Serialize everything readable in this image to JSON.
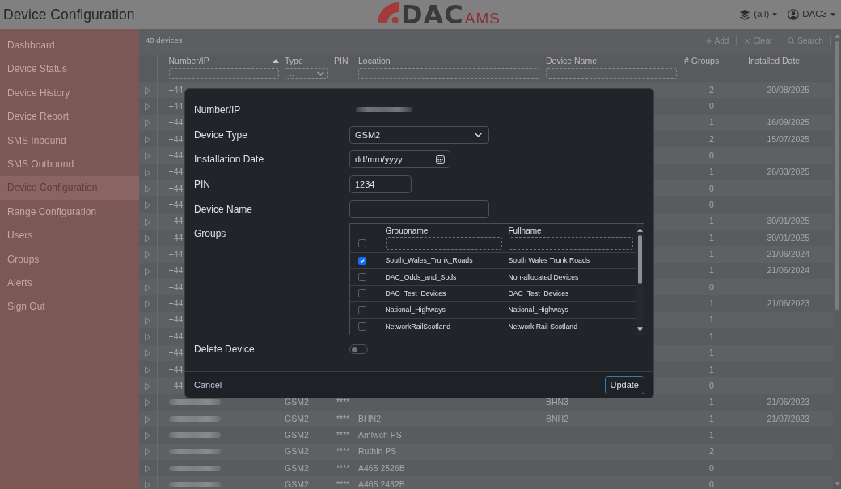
{
  "header": {
    "title": "Device Configuration",
    "logo": {
      "main": "DAC",
      "sub": "AMS"
    },
    "group_filter": "(all)",
    "user": "DAC3"
  },
  "sidebar": {
    "items": [
      {
        "label": "Dashboard",
        "selected": false
      },
      {
        "label": "Device Status",
        "selected": false
      },
      {
        "label": "Device History",
        "selected": false
      },
      {
        "label": "Device Report",
        "selected": false
      },
      {
        "label": "SMS Inbound",
        "selected": false
      },
      {
        "label": "SMS Outbound",
        "selected": false
      },
      {
        "label": "Device Configuration",
        "selected": true
      },
      {
        "label": "Range Configuration",
        "selected": false
      },
      {
        "label": "Users",
        "selected": false
      },
      {
        "label": "Groups",
        "selected": false
      },
      {
        "label": "Alerts",
        "selected": false
      },
      {
        "label": "Sign Out",
        "selected": false
      }
    ]
  },
  "toolbar": {
    "count": "40 devices",
    "actions": [
      {
        "kind": "add",
        "label": "Add"
      },
      {
        "kind": "clear",
        "label": "Clear"
      },
      {
        "kind": "search",
        "label": "Search"
      }
    ]
  },
  "table": {
    "columns": [
      {
        "label": "Number/IP",
        "sorted_ascending": true,
        "filter": {
          "kind": "text"
        }
      },
      {
        "label": "Type",
        "filter": {
          "kind": "select",
          "value": "..."
        }
      },
      {
        "label": "PIN"
      },
      {
        "label": "Location",
        "filter": {
          "kind": "text"
        }
      },
      {
        "label": "Device Name",
        "filter": {
          "kind": "text"
        }
      },
      {
        "label": "# Groups"
      },
      {
        "label": "Installed Date"
      }
    ],
    "rows": [
      {
        "number": "+44",
        "groups": "2",
        "installed": "20/08/2025"
      },
      {
        "number": "+44",
        "groups": "0"
      },
      {
        "number": "+44",
        "groups": "1",
        "installed": "16/09/2025"
      },
      {
        "number": "+44",
        "groups": "2",
        "installed": "15/07/2025"
      },
      {
        "number": "+44",
        "groups": "0"
      },
      {
        "number": "+44",
        "groups": "1",
        "installed": "26/03/2025"
      },
      {
        "number": "+44",
        "groups": "0"
      },
      {
        "number": "+44",
        "groups": "0"
      },
      {
        "number": "+44",
        "groups": "1",
        "installed": "30/01/2025"
      },
      {
        "number": "+44",
        "groups": "1",
        "installed": "30/01/2025"
      },
      {
        "number": "+44",
        "groups": "1",
        "installed": "21/06/2024"
      },
      {
        "number": "+44",
        "groups": "1",
        "installed": "21/06/2024"
      },
      {
        "number": "+44",
        "groups": "0"
      },
      {
        "number": "+44",
        "groups": "1",
        "installed": "21/06/2023"
      },
      {
        "number": "+44",
        "groups": "1"
      },
      {
        "number": "+44",
        "groups": "1"
      },
      {
        "number": "+44",
        "groups": "1"
      },
      {
        "number": "+44",
        "groups": "1"
      },
      {
        "number": "+44",
        "groups": "0"
      },
      {
        "blurred": true,
        "type": "GSM2",
        "pin": "****",
        "device_name": "BHN3",
        "groups": "1",
        "installed": "21/06/2023"
      },
      {
        "blurred": true,
        "type": "GSM2",
        "pin": "****",
        "location": "BHN2",
        "device_name": "BNH2",
        "groups": "1",
        "installed": "21/07/2023"
      },
      {
        "blurred": true,
        "type": "GSM2",
        "pin": "****",
        "location": "Amlwch PS",
        "groups": "1"
      },
      {
        "blurred": true,
        "type": "GSM2",
        "pin": "****",
        "location": "Ruthin PS",
        "groups": "2"
      },
      {
        "blurred": true,
        "type": "GSM2",
        "pin": "****",
        "location": "A465 2526B",
        "groups": "0"
      },
      {
        "blurred": true,
        "type": "GSM2",
        "pin": "****",
        "location": "A465 2432B",
        "groups": "0"
      }
    ]
  },
  "dialog": {
    "fields": [
      {
        "kind": "static",
        "label": "Number/IP",
        "blurred": true
      },
      {
        "kind": "select",
        "label": "Device Type",
        "value": "GSM2"
      },
      {
        "kind": "date",
        "label": "Installation Date",
        "placeholder": "dd/mm/yyyy"
      },
      {
        "kind": "number",
        "label": "PIN",
        "value": "1234"
      },
      {
        "kind": "text",
        "label": "Device Name"
      },
      {
        "kind": "groups",
        "label": "Groups",
        "columns": [
          "Groupname",
          "Fullname"
        ],
        "select_all": false,
        "rows": [
          {
            "groupname": "South_Wales_Trunk_Roads",
            "fullname": "South Wales Trunk Roads",
            "checked": true
          },
          {
            "groupname": "DAC_Odds_and_Sods",
            "fullname": "Non-allocated Devices",
            "checked": false
          },
          {
            "groupname": "DAC_Test_Devices",
            "fullname": "DAC_Test_Devices",
            "checked": false
          },
          {
            "groupname": "National_Highways",
            "fullname": "National_Highways",
            "checked": false
          },
          {
            "groupname": "NetworkRailScotland",
            "fullname": "Network Rail Scotland",
            "checked": false
          }
        ]
      },
      {
        "kind": "switch",
        "label": "Delete Device",
        "on": false
      }
    ],
    "cancel": "Cancel",
    "submit": "Update"
  }
}
